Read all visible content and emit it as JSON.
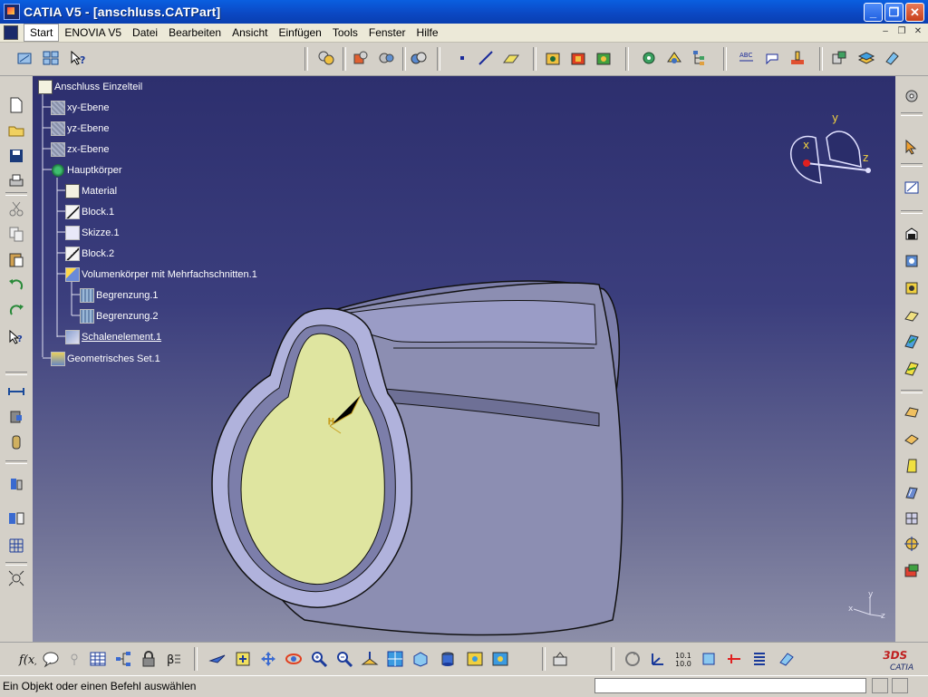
{
  "window": {
    "title": "CATIA V5 - [anschluss.CATPart]",
    "controls": {
      "minimize": "_",
      "maximize": "❐",
      "close": "✕"
    }
  },
  "menubar": {
    "items": [
      {
        "label": "Start",
        "active": true
      },
      {
        "label": "ENOVIA V5"
      },
      {
        "label": "Datei"
      },
      {
        "label": "Bearbeiten"
      },
      {
        "label": "Ansicht"
      },
      {
        "label": "Einfügen"
      },
      {
        "label": "Tools"
      },
      {
        "label": "Fenster"
      },
      {
        "label": "Hilfe"
      }
    ],
    "doc_controls": {
      "minimize": "–",
      "restore": "❐",
      "close": "✕"
    }
  },
  "tree": {
    "root": "Anschluss Einzelteil",
    "nodes": [
      {
        "label": "xy-Ebene",
        "icon": "plane-icon"
      },
      {
        "label": "yz-Ebene",
        "icon": "plane-icon"
      },
      {
        "label": "zx-Ebene",
        "icon": "plane-icon"
      },
      {
        "label": "Hauptkörper",
        "icon": "body-gear-icon"
      },
      {
        "label": "Material",
        "icon": "material-icon"
      },
      {
        "label": "Block.1",
        "icon": "pad-icon"
      },
      {
        "label": "Skizze.1",
        "icon": "sketch-icon"
      },
      {
        "label": "Block.2",
        "icon": "pad-icon"
      },
      {
        "label": "Volumenkörper mit Mehrfachschnitten.1",
        "icon": "multisection-icon"
      },
      {
        "label": "Begrenzung.1",
        "icon": "boundary-icon"
      },
      {
        "label": "Begrenzung.2",
        "icon": "boundary-icon"
      },
      {
        "label": "Schalenelement.1",
        "icon": "shell-icon"
      },
      {
        "label": "Geometrisches Set.1",
        "icon": "geoset-icon"
      }
    ]
  },
  "compass": {
    "x": "x",
    "y": "y",
    "z": "z"
  },
  "axis_indicator": {
    "x": "x",
    "y": "y",
    "z": "z"
  },
  "status": {
    "message": "Ein Objekt oder einen Befehl auswählen"
  },
  "brand": {
    "logo_text": "CATIA"
  },
  "colors": {
    "viewport_top": "#2d2f6e",
    "viewport_bottom": "#8c8ea8",
    "part_face": "#dfe5a0",
    "part_body": "#9a9cc8"
  }
}
